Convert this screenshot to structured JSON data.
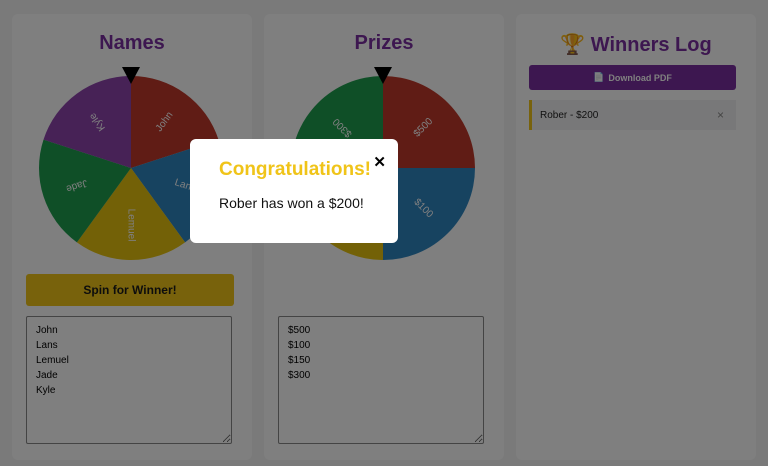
{
  "names_panel": {
    "title": "Names",
    "spin_button": "Spin for Winner!",
    "entries_text": "John\nLans\nLemuel\nJade\nKyle",
    "wheel": {
      "slices": [
        {
          "label": "John",
          "color": "#c0392b"
        },
        {
          "label": "Lans",
          "color": "#2e86c1"
        },
        {
          "label": "Lemuel",
          "color": "#e6c20f"
        },
        {
          "label": "Jade",
          "color": "#1e9e4f"
        },
        {
          "label": "Kyle",
          "color": "#8e44ad"
        }
      ]
    }
  },
  "prizes_panel": {
    "title": "Prizes",
    "entries_text": "$500\n$100\n$150\n$300",
    "wheel": {
      "slices": [
        {
          "label": "$500",
          "color": "#c0392b"
        },
        {
          "label": "$100",
          "color": "#2e86c1"
        },
        {
          "label": "$150",
          "color": "#e6c20f"
        },
        {
          "label": "$300",
          "color": "#1e9e4f"
        }
      ]
    }
  },
  "log_panel": {
    "trophy_icon": "🏆",
    "title": "Winners Log",
    "pdf_icon": "📄",
    "pdf_button": "Download PDF",
    "entries": [
      {
        "text": "Rober - $200",
        "remove": "×"
      }
    ]
  },
  "modal": {
    "title": "Congratulations!",
    "message": "Rober has won a $200!",
    "close": "✕"
  },
  "colors": {
    "accent_purple": "#7a2ea0",
    "accent_yellow": "#f0c419"
  }
}
